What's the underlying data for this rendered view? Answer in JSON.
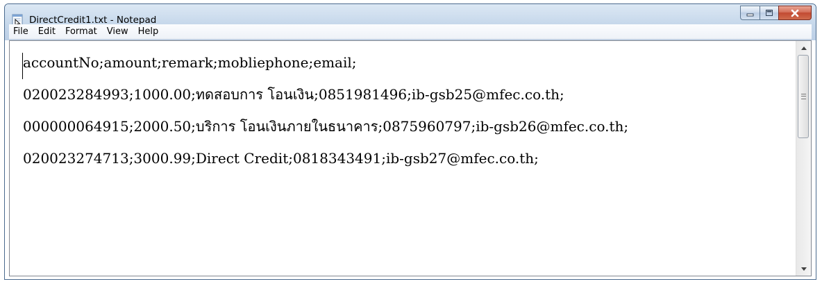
{
  "window": {
    "title": "DirectCredit1.txt - Notepad"
  },
  "menu": [
    "File",
    "Edit",
    "Format",
    "View",
    "Help"
  ],
  "document": {
    "lines": [
      "accountNo;amount;remark;mobliephone;email;",
      "020023284993;1000.00;ทดสอบการ โอนเงิน;0851981496;ib-gsb25@mfec.co.th;",
      "000000064915;2000.50;บริการ โอนเงินภายในธนาคาร;0875960797;ib-gsb26@mfec.co.th;",
      "020023274713;3000.99;Direct Credit;0818343491;ib-gsb27@mfec.co.th;"
    ]
  },
  "icons": {
    "app": "notepad-icon",
    "minimize": "minimize-icon",
    "maximize": "maximize-icon",
    "close": "close-icon",
    "scroll_up": "scroll-up-arrow-icon",
    "scroll_down": "scroll-down-arrow-icon"
  },
  "colors": {
    "close_button": "#c24a32",
    "titlebar": "#c4d6ea"
  }
}
